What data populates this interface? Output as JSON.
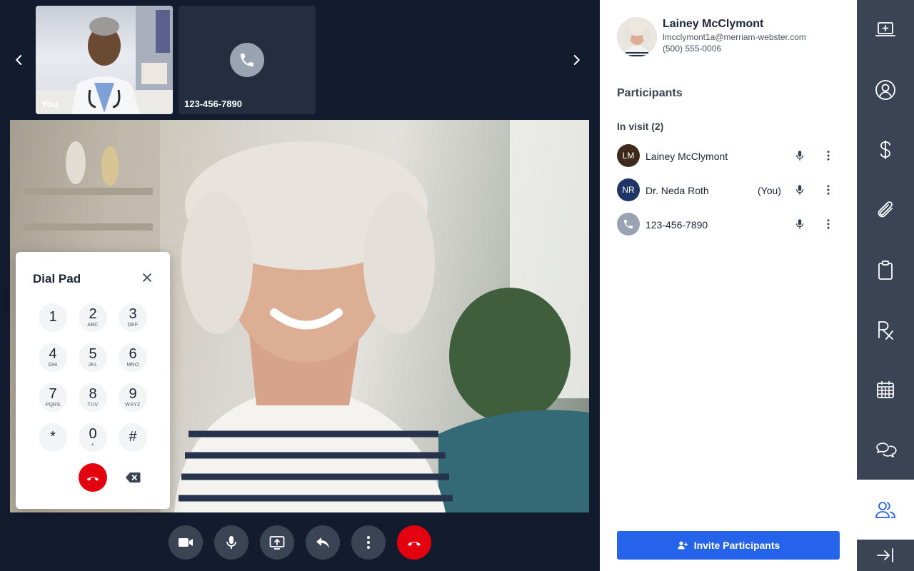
{
  "thumbnails": [
    {
      "label": "You"
    },
    {
      "label": "123-456-7890"
    }
  ],
  "dial_pad": {
    "title": "Dial Pad",
    "keys": [
      {
        "digit": "1",
        "letters": ""
      },
      {
        "digit": "2",
        "letters": "ABC"
      },
      {
        "digit": "3",
        "letters": "DEF"
      },
      {
        "digit": "4",
        "letters": "GHI"
      },
      {
        "digit": "5",
        "letters": "JKL"
      },
      {
        "digit": "6",
        "letters": "MNO"
      },
      {
        "digit": "7",
        "letters": "PQRS"
      },
      {
        "digit": "8",
        "letters": "TUV"
      },
      {
        "digit": "9",
        "letters": "WXYZ"
      },
      {
        "digit": "*",
        "letters": ""
      },
      {
        "digit": "0",
        "letters": "+"
      },
      {
        "digit": "#",
        "letters": ""
      }
    ]
  },
  "patient": {
    "name": "Lainey McClymont",
    "email": "lmcclymont1a@merriam-webster.com",
    "phone": "(500) 555-0006"
  },
  "participants": {
    "heading": "Participants",
    "in_visit_label": "In visit (2)",
    "list": [
      {
        "initials": "LM",
        "name": "Lainey McClymont",
        "you": "",
        "avatar_color": "#3d2a1c"
      },
      {
        "initials": "NR",
        "name": "Dr. Neda Roth",
        "you": "(You)",
        "avatar_color": "#1f3566"
      },
      {
        "initials": "",
        "name": "123-456-7890",
        "you": "",
        "avatar_color": "#9aa3b1"
      }
    ]
  },
  "invite_button_label": "Invite Participants",
  "colors": {
    "accent": "#2563eb",
    "end_call": "#e3000f",
    "rail": "#3b4455",
    "video_bg": "#131b2e"
  },
  "controls": [
    {
      "icon": "video-camera-icon"
    },
    {
      "icon": "microphone-icon"
    },
    {
      "icon": "screen-share-icon"
    },
    {
      "icon": "reply-icon"
    },
    {
      "icon": "more-vertical-icon"
    },
    {
      "icon": "end-call-icon"
    }
  ],
  "rail_icons": [
    "laptop-medical-icon",
    "user-circle-icon",
    "dollar-icon",
    "paperclip-icon",
    "clipboard-icon",
    "prescription-icon",
    "calendar-icon",
    "chat-icon",
    "users-icon",
    "collapse-panel-icon"
  ]
}
